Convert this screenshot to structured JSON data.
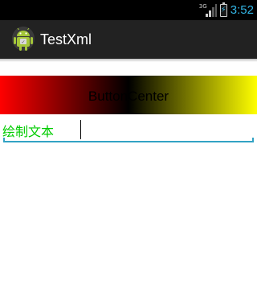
{
  "status_bar": {
    "network_type": "3G",
    "time": "3:52",
    "accent_color": "#33b5e5"
  },
  "action_bar": {
    "icon": "android-robot-icon",
    "title": "TestXml",
    "background_color": "#222222"
  },
  "gradient_button": {
    "label": "ButtonCenter",
    "gradient_colors": [
      "#ff0000",
      "#000000",
      "#ffff00"
    ]
  },
  "edit_text": {
    "label": "绘制文本",
    "label_color": "#00cc00",
    "value": "",
    "underline_color": "#33a3c4"
  }
}
